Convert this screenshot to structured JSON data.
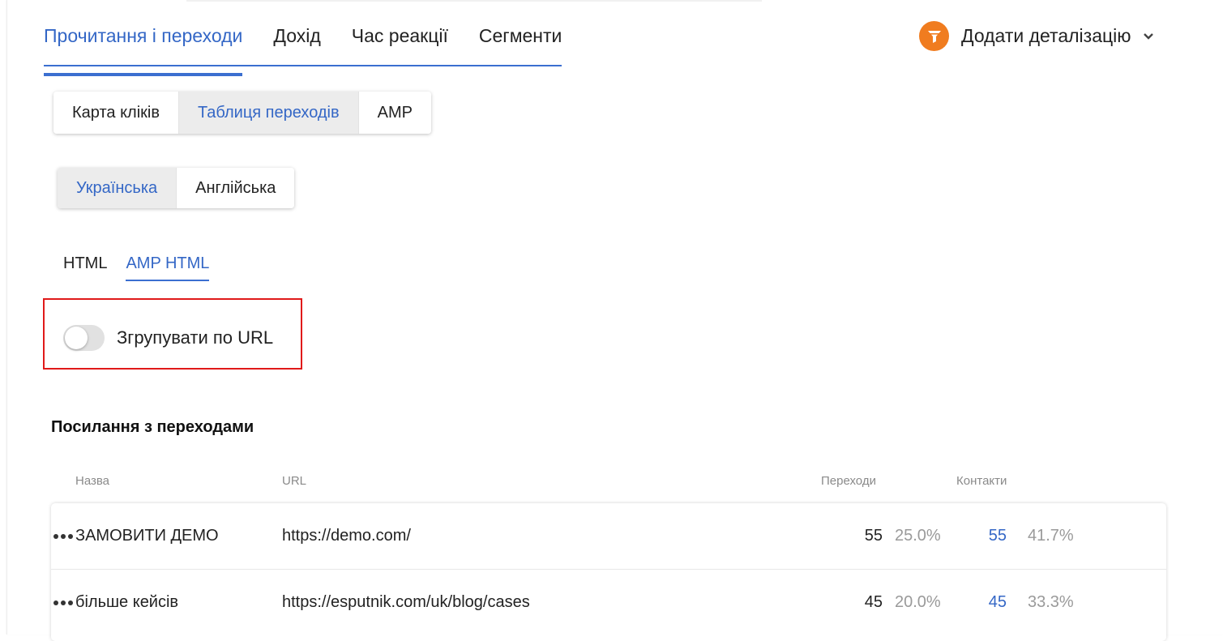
{
  "main_tabs": [
    {
      "label": "Прочитання і переходи",
      "active": true
    },
    {
      "label": "Дохід",
      "active": false
    },
    {
      "label": "Час реакції",
      "active": false
    },
    {
      "label": "Сегменти",
      "active": false
    }
  ],
  "add_detail": {
    "label": "Додати деталізацію",
    "icon": "funnel-icon",
    "accent": "#f07c1f"
  },
  "view_buttons": [
    {
      "label": "Карта кліків",
      "active": false
    },
    {
      "label": "Таблиця переходів",
      "active": true
    },
    {
      "label": "AMP",
      "active": false
    }
  ],
  "language_buttons": [
    {
      "label": "Українська",
      "active": true
    },
    {
      "label": "Англійська",
      "active": false
    }
  ],
  "format_tabs": [
    {
      "label": "HTML",
      "active": false
    },
    {
      "label": "AMP HTML",
      "active": true
    }
  ],
  "group_toggle": {
    "label": "Згрупувати по URL",
    "on": false
  },
  "section_title": "Посилання з переходами",
  "table": {
    "headers": {
      "name": "Назва",
      "url": "URL",
      "clicks": "Переходи",
      "contacts": "Контакти"
    },
    "rows": [
      {
        "name": "ЗАМОВИТИ ДЕМО",
        "url": "https://demo.com/",
        "clicks": "55",
        "clicks_pct": "25.0%",
        "contacts": "55",
        "contacts_pct": "41.7%"
      },
      {
        "name": "більше кейсів",
        "url": "https://esputnik.com/uk/blog/cases",
        "clicks": "45",
        "clicks_pct": "20.0%",
        "contacts": "45",
        "contacts_pct": "33.3%"
      }
    ]
  },
  "colors": {
    "accent": "#3467c6",
    "highlight": "#e01a1a",
    "orange": "#f07c1f"
  }
}
